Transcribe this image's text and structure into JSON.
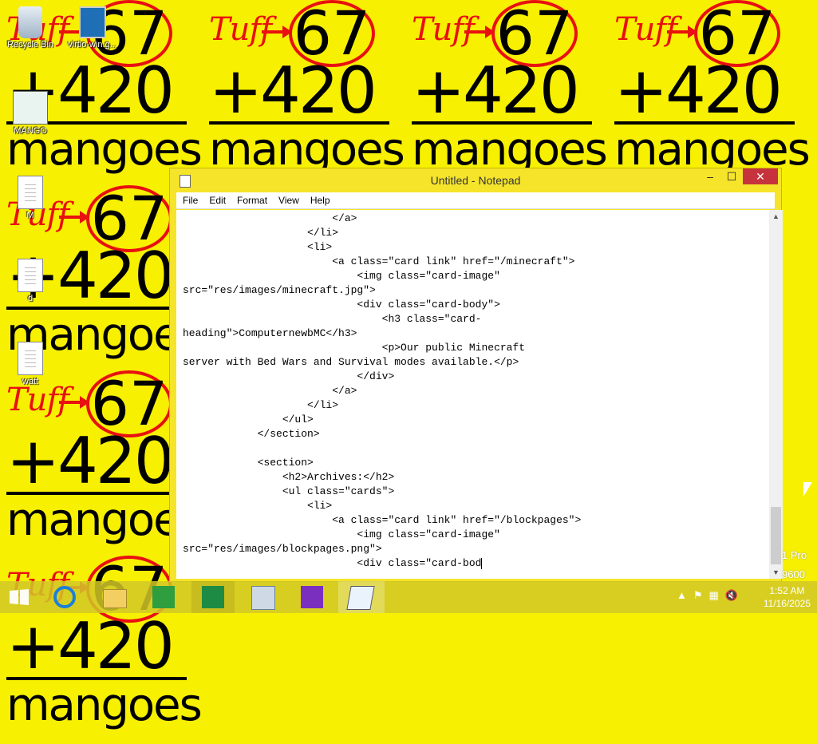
{
  "desktop": {
    "wallpaper": {
      "text_top": "Tuff",
      "num1": "67",
      "num2": "+420",
      "word": "mangoes",
      "bg": "#f7f000",
      "accent": "#e81010"
    },
    "icons": [
      {
        "label": "Recycle Bin",
        "icon": "recycle-bin-icon"
      },
      {
        "label": "virtio-win.g...",
        "icon": "installer-icon"
      },
      {
        "label": "MANGO",
        "icon": "image-file-icon"
      },
      {
        "label": "M",
        "icon": "text-file-icon"
      },
      {
        "label": "d",
        "icon": "text-file-icon"
      },
      {
        "label": "watt",
        "icon": "text-file-icon"
      }
    ]
  },
  "notepad": {
    "title": "Untitled - Notepad",
    "controls": {
      "minimize": "–",
      "maximize": "☐",
      "close": "✕"
    },
    "menu": [
      "File",
      "Edit",
      "Format",
      "View",
      "Help"
    ],
    "lines": [
      "                                                </a>",
      "                                        </li>",
      "                                        <li>",
      "                                                <a class=\"card link\" href=\"/minecraft\">",
      "                                                        <img class=\"card-image\"",
      "src=\"res/images/minecraft.jpg\">",
      "                                                        <div class=\"card-body\">",
      "                                                                <h3 class=\"card-",
      "heading\">ComputernewbMC</h3>",
      "                                                                <p>Our public Minecraft",
      "server with Bed Wars and Survival modes available.</p>",
      "                                                        </div>",
      "                                                </a>",
      "                                        </li>",
      "                                </ul>",
      "                        </section>",
      "",
      "                        <section>",
      "                                <h2>Archives:</h2>",
      "                                <ul class=\"cards\">",
      "                                        <li>",
      "                                                <a class=\"card link\" href=\"/blockpages\">",
      "                                                        <img class=\"card-image\"",
      "src=\"res/images/blockpages.png\">",
      "                                                        <div class=\"card-bod"
    ]
  },
  "taskbar": {
    "apps": [
      "start-icon",
      "internet-explorer-icon",
      "file-explorer-icon",
      "store-icon",
      "task-manager-icon",
      "performance-monitor-icon",
      "search-app-icon",
      "notepad-icon"
    ],
    "time": "1:52 AM",
    "date": "11/16/2025"
  },
  "watermark": {
    "line1": "1 Pro",
    "line2": "9600"
  }
}
